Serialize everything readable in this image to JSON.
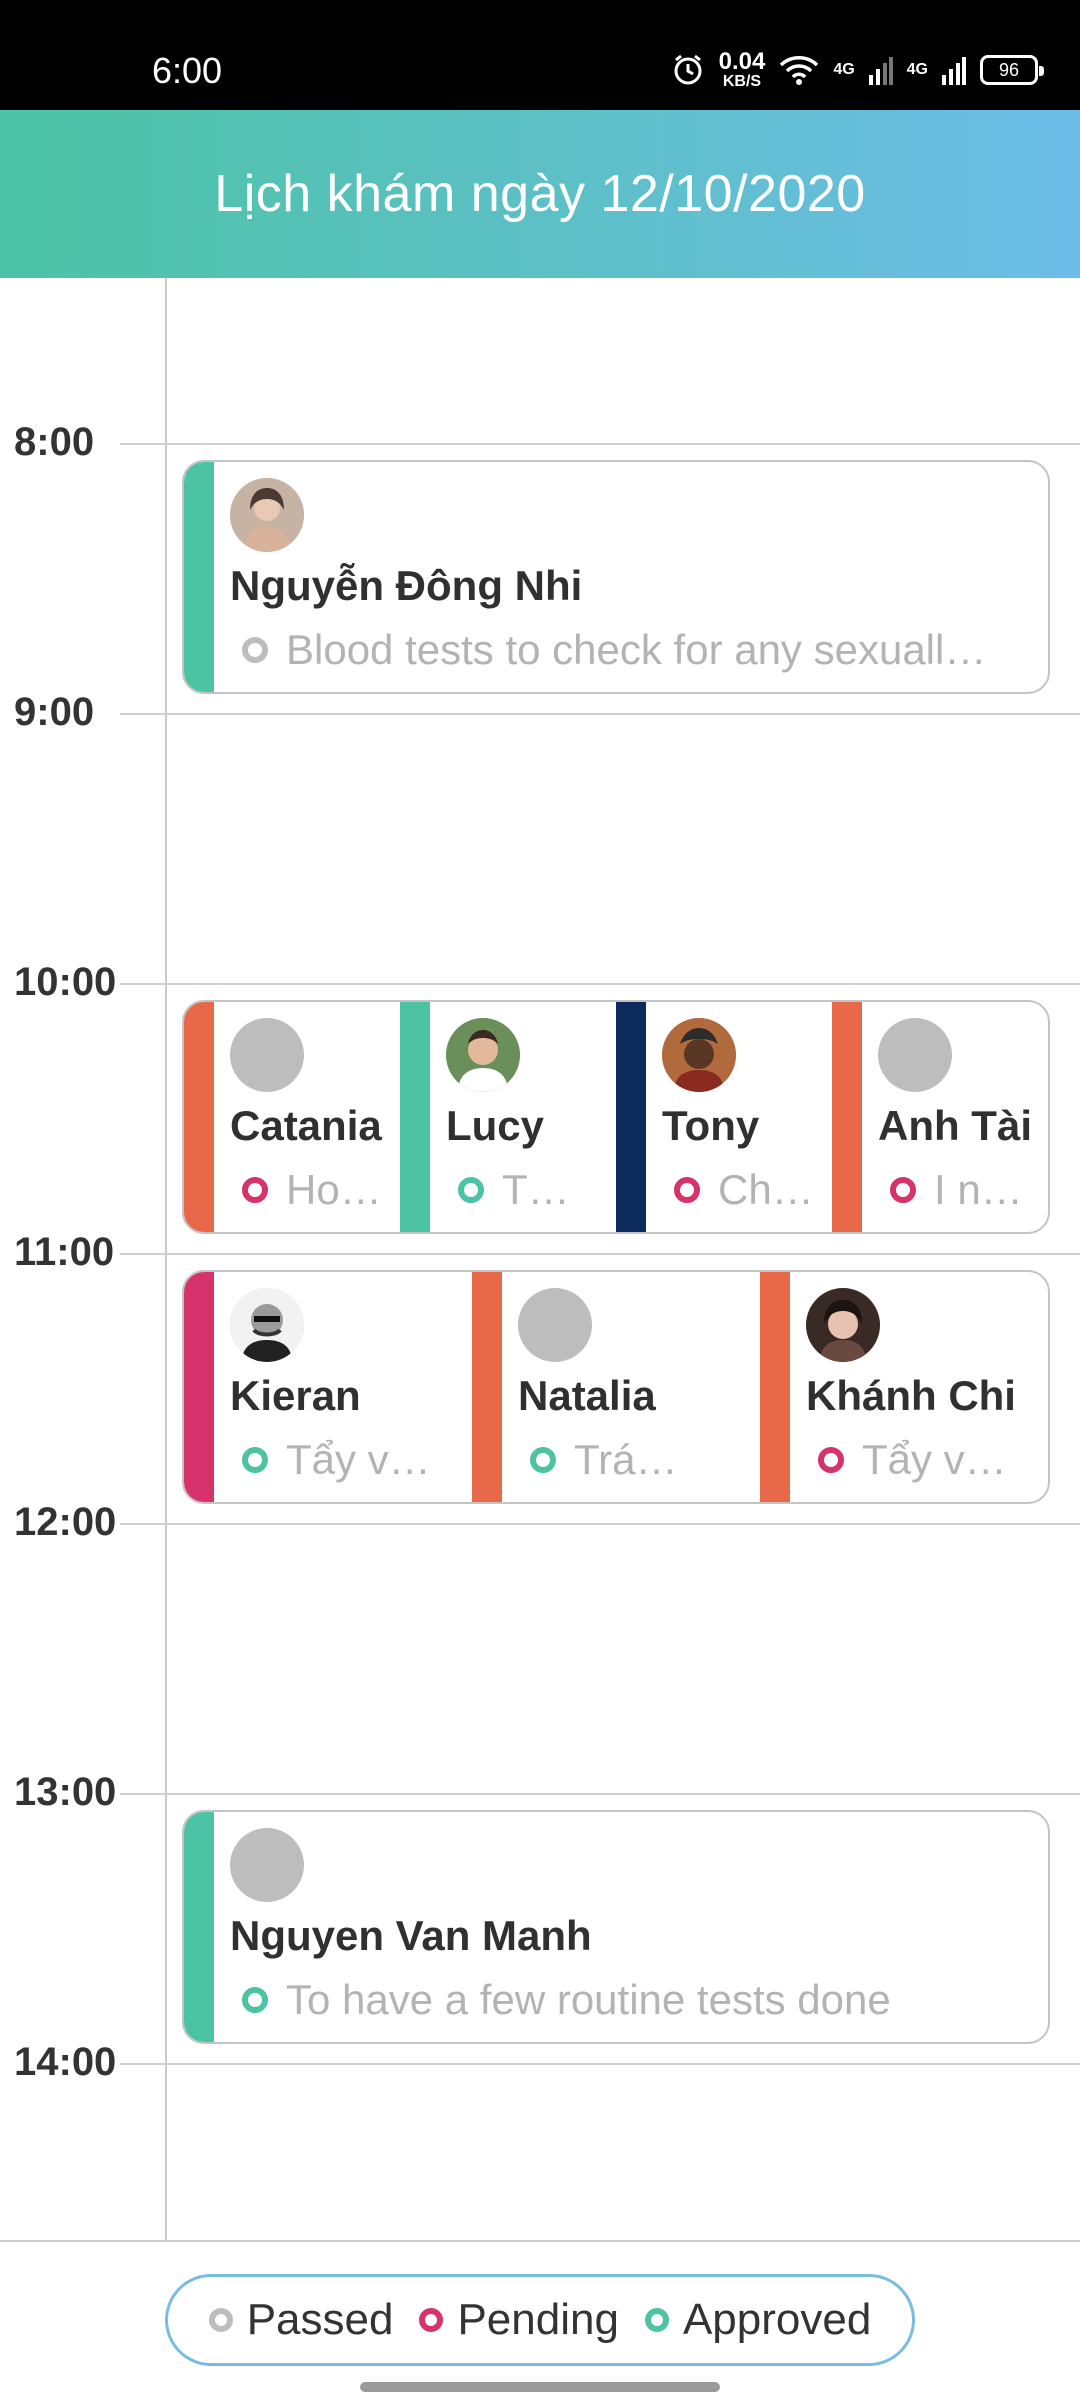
{
  "status_bar": {
    "time": "6:00",
    "speed_value": "0.04",
    "speed_unit": "KB/S",
    "network_1": "4G",
    "network_2": "4G",
    "battery": "96",
    "icons": [
      "alarm-icon",
      "wifi-icon",
      "signal-icon",
      "signal-icon",
      "battery-icon"
    ]
  },
  "header": {
    "title": "Lịch khám ngày 12/10/2020"
  },
  "timeline": {
    "hours": [
      "8:00",
      "9:00",
      "10:00",
      "11:00",
      "12:00",
      "13:00",
      "14:00"
    ]
  },
  "colors": {
    "passed": "#bdbdbd",
    "pending": "#d6336c",
    "approved": "#4cc3a3",
    "orange": "#e8694a",
    "navy": "#0c2a5c",
    "magenta": "#d6336c",
    "teal": "#4cc3a3"
  },
  "events": [
    {
      "group": "8:00",
      "items": [
        {
          "name": "Nguyễn Đông Nhi",
          "desc": "Blood tests to check for any sexuall…",
          "status": "passed",
          "bar": "teal",
          "avatar": "photo"
        }
      ]
    },
    {
      "group": "10:00",
      "items": [
        {
          "name": "Catania",
          "desc": "Hol…",
          "status": "pending",
          "bar": "orange",
          "avatar": "placeholder"
        },
        {
          "name": "Lucy",
          "desc": "T…",
          "status": "approved",
          "bar": "teal",
          "avatar": "photo"
        },
        {
          "name": "Tony",
          "desc": "Ch…",
          "status": "pending",
          "bar": "navy",
          "avatar": "photo"
        },
        {
          "name": "Anh Tài",
          "desc": "I ne…",
          "status": "pending",
          "bar": "orange",
          "avatar": "placeholder"
        }
      ]
    },
    {
      "group": "11:00",
      "items": [
        {
          "name": "Kieran",
          "desc": "Tẩy v…",
          "status": "approved",
          "bar": "magenta",
          "avatar": "photo"
        },
        {
          "name": "Natalia",
          "desc": "Trá…",
          "status": "approved",
          "bar": "orange",
          "avatar": "placeholder"
        },
        {
          "name": "Khánh Chi",
          "desc": "Tẩy v…",
          "status": "pending",
          "bar": "orange",
          "avatar": "photo"
        }
      ]
    },
    {
      "group": "13:00",
      "items": [
        {
          "name": "Nguyen Van Manh",
          "desc": "To have a few routine tests done",
          "status": "approved",
          "bar": "teal",
          "avatar": "placeholder"
        }
      ]
    }
  ],
  "legend": {
    "passed": "Passed",
    "pending": "Pending",
    "approved": "Approved"
  }
}
